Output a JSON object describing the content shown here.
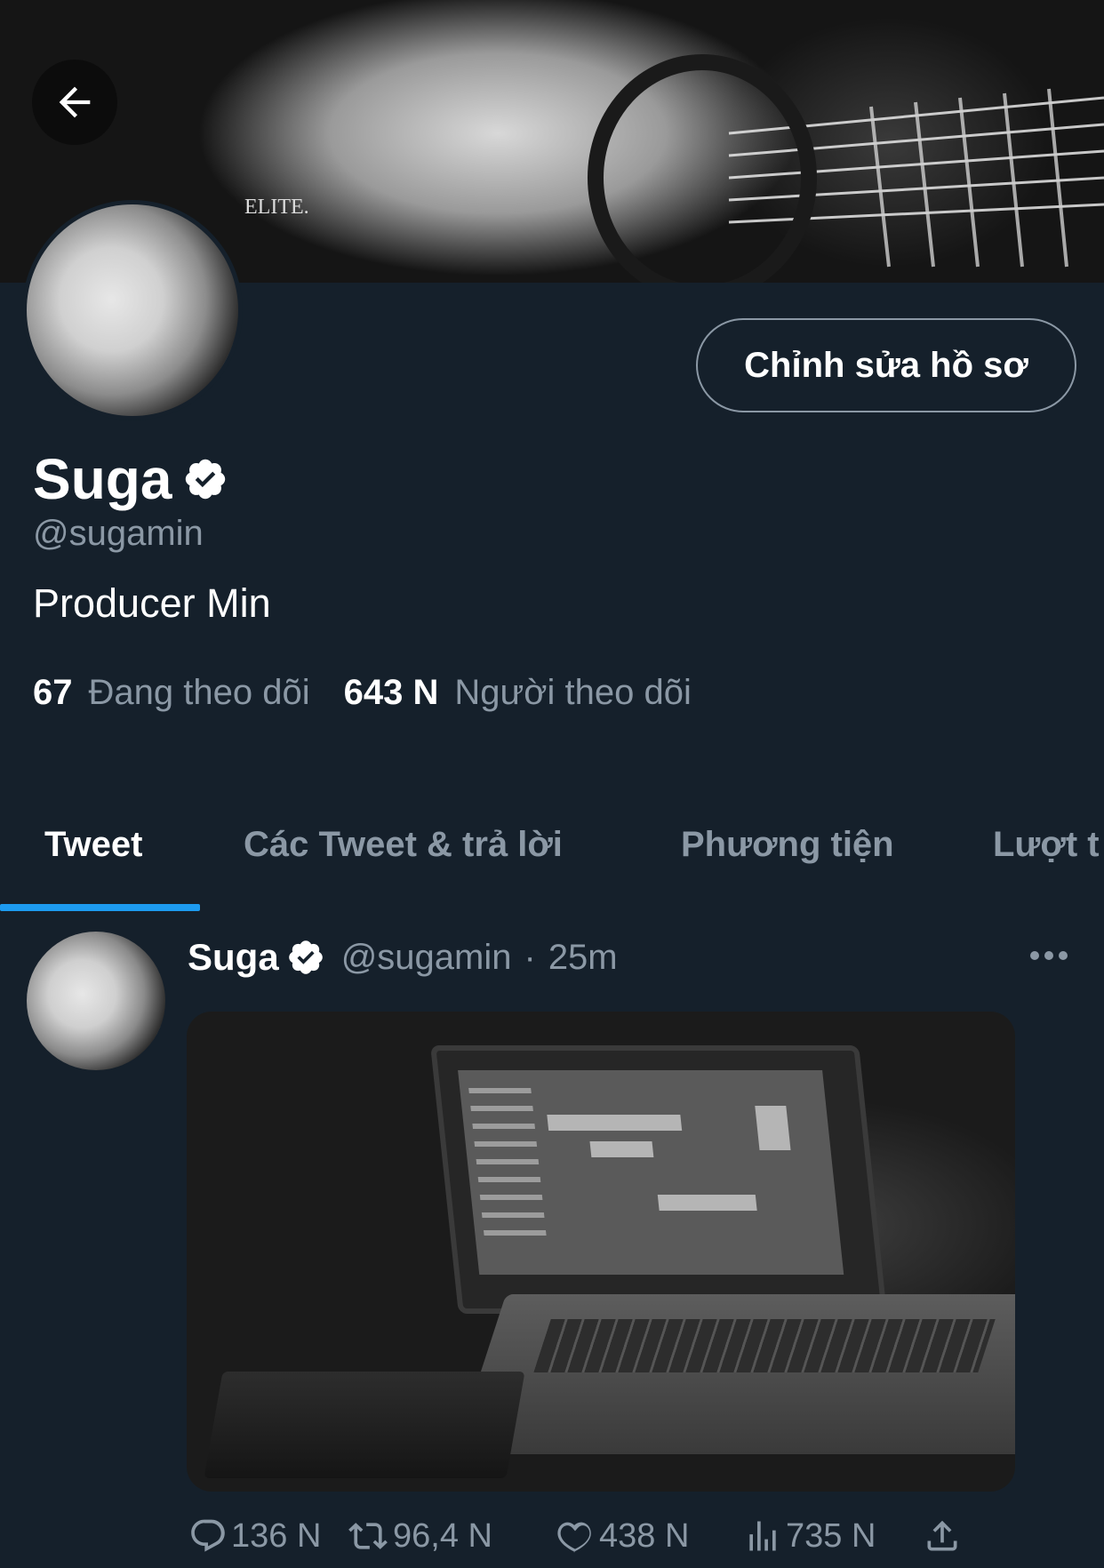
{
  "profile": {
    "display_name": "Suga",
    "handle": "@sugamin",
    "bio": "Producer Min",
    "edit_button": "Chỉnh sửa hồ sơ",
    "following_count": "67",
    "following_label": "Đang theo dõi",
    "followers_count": "643 N",
    "followers_label": "Người theo dõi",
    "banner_watermark": "ELITE."
  },
  "tabs": [
    {
      "label": "Tweet",
      "active": true
    },
    {
      "label": "Các Tweet & trả lời",
      "active": false
    },
    {
      "label": "Phương tiện",
      "active": false
    },
    {
      "label": "Lượt t",
      "active": false
    }
  ],
  "tweet": {
    "name": "Suga",
    "handle": "@sugamin",
    "separator": "·",
    "time": "25m",
    "replies": "136 N",
    "retweets": "96,4 N",
    "likes": "438 N",
    "views": "735 N"
  },
  "icons": {
    "back": "arrow-left-icon",
    "verified": "verified-badge-icon",
    "more": "more-horizontal-icon",
    "reply": "reply-icon",
    "retweet": "retweet-icon",
    "like": "heart-icon",
    "views": "views-icon",
    "share": "share-icon"
  },
  "colors": {
    "background": "#15202b",
    "accent": "#1d9bf0",
    "muted": "#8b98a5"
  }
}
